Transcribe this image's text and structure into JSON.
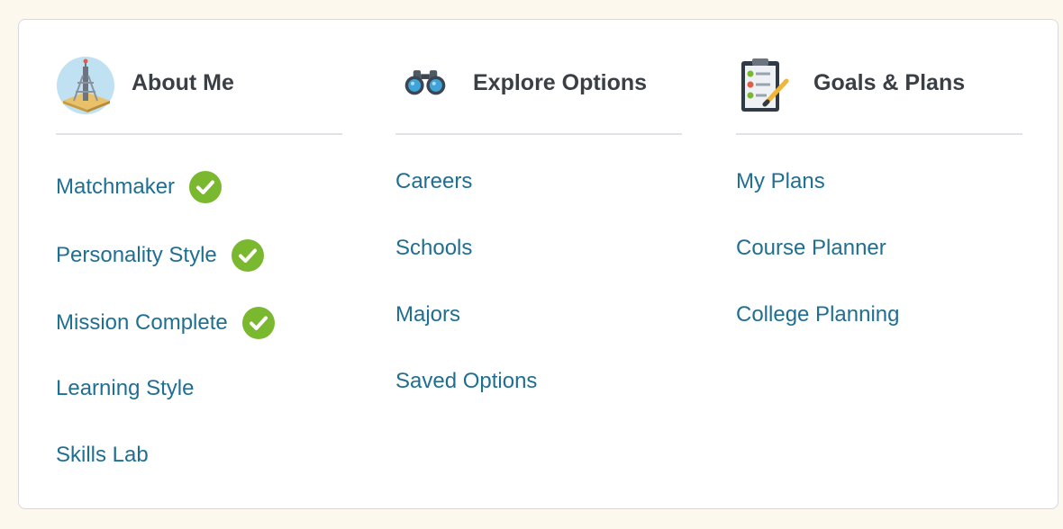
{
  "columns": [
    {
      "title": "About Me",
      "icon": "tower-icon",
      "items": [
        {
          "label": "Matchmaker",
          "completed": true
        },
        {
          "label": "Personality Style",
          "completed": true
        },
        {
          "label": "Mission Complete",
          "completed": true
        },
        {
          "label": "Learning Style",
          "completed": false
        },
        {
          "label": "Skills Lab",
          "completed": false
        }
      ]
    },
    {
      "title": "Explore Options",
      "icon": "binoculars-icon",
      "items": [
        {
          "label": "Careers"
        },
        {
          "label": "Schools"
        },
        {
          "label": "Majors"
        },
        {
          "label": "Saved Options"
        }
      ]
    },
    {
      "title": "Goals & Plans",
      "icon": "clipboard-checklist-icon",
      "items": [
        {
          "label": "My Plans"
        },
        {
          "label": "Course Planner"
        },
        {
          "label": "College Planning"
        }
      ]
    }
  ],
  "colors": {
    "link": "#1f6f93",
    "heading": "#3a3f46",
    "check": "#7ab82f",
    "divider": "#dfe3e8",
    "page_background": "#fdf8ee"
  }
}
